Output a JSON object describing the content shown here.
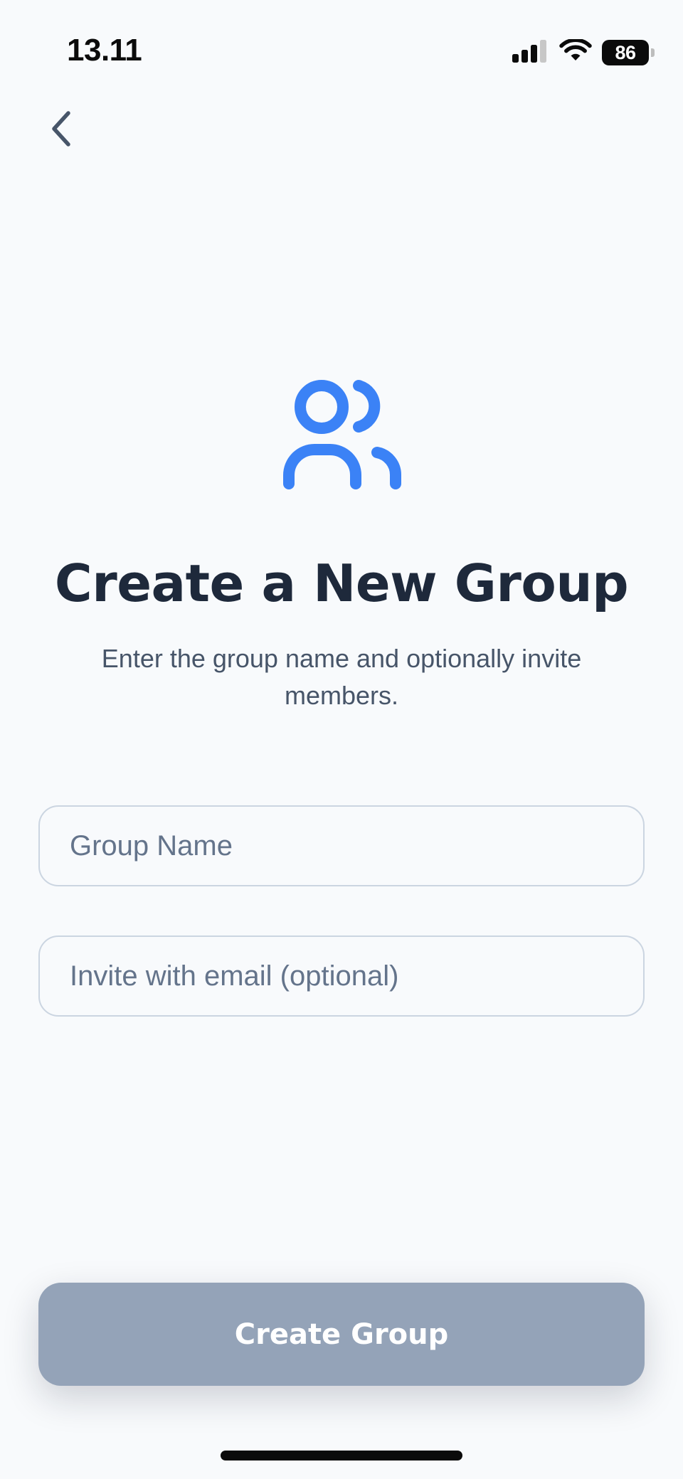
{
  "status_bar": {
    "time": "13.11",
    "battery_level": "86",
    "signal_icon": "cellular-signal-icon",
    "wifi_icon": "wifi-icon",
    "battery_icon": "battery-icon"
  },
  "nav": {
    "back_icon": "chevron-left-icon"
  },
  "hero": {
    "icon": "users-group-icon",
    "icon_color": "#3b82f6",
    "title": "Create a New Group",
    "subtitle": "Enter the group name and optionally invite members."
  },
  "form": {
    "group_name": {
      "value": "",
      "placeholder": "Group Name"
    },
    "invite_email": {
      "value": "",
      "placeholder": "Invite with email (optional)"
    }
  },
  "actions": {
    "create_label": "Create Group",
    "create_enabled": false,
    "create_color": "#94a3b8"
  }
}
